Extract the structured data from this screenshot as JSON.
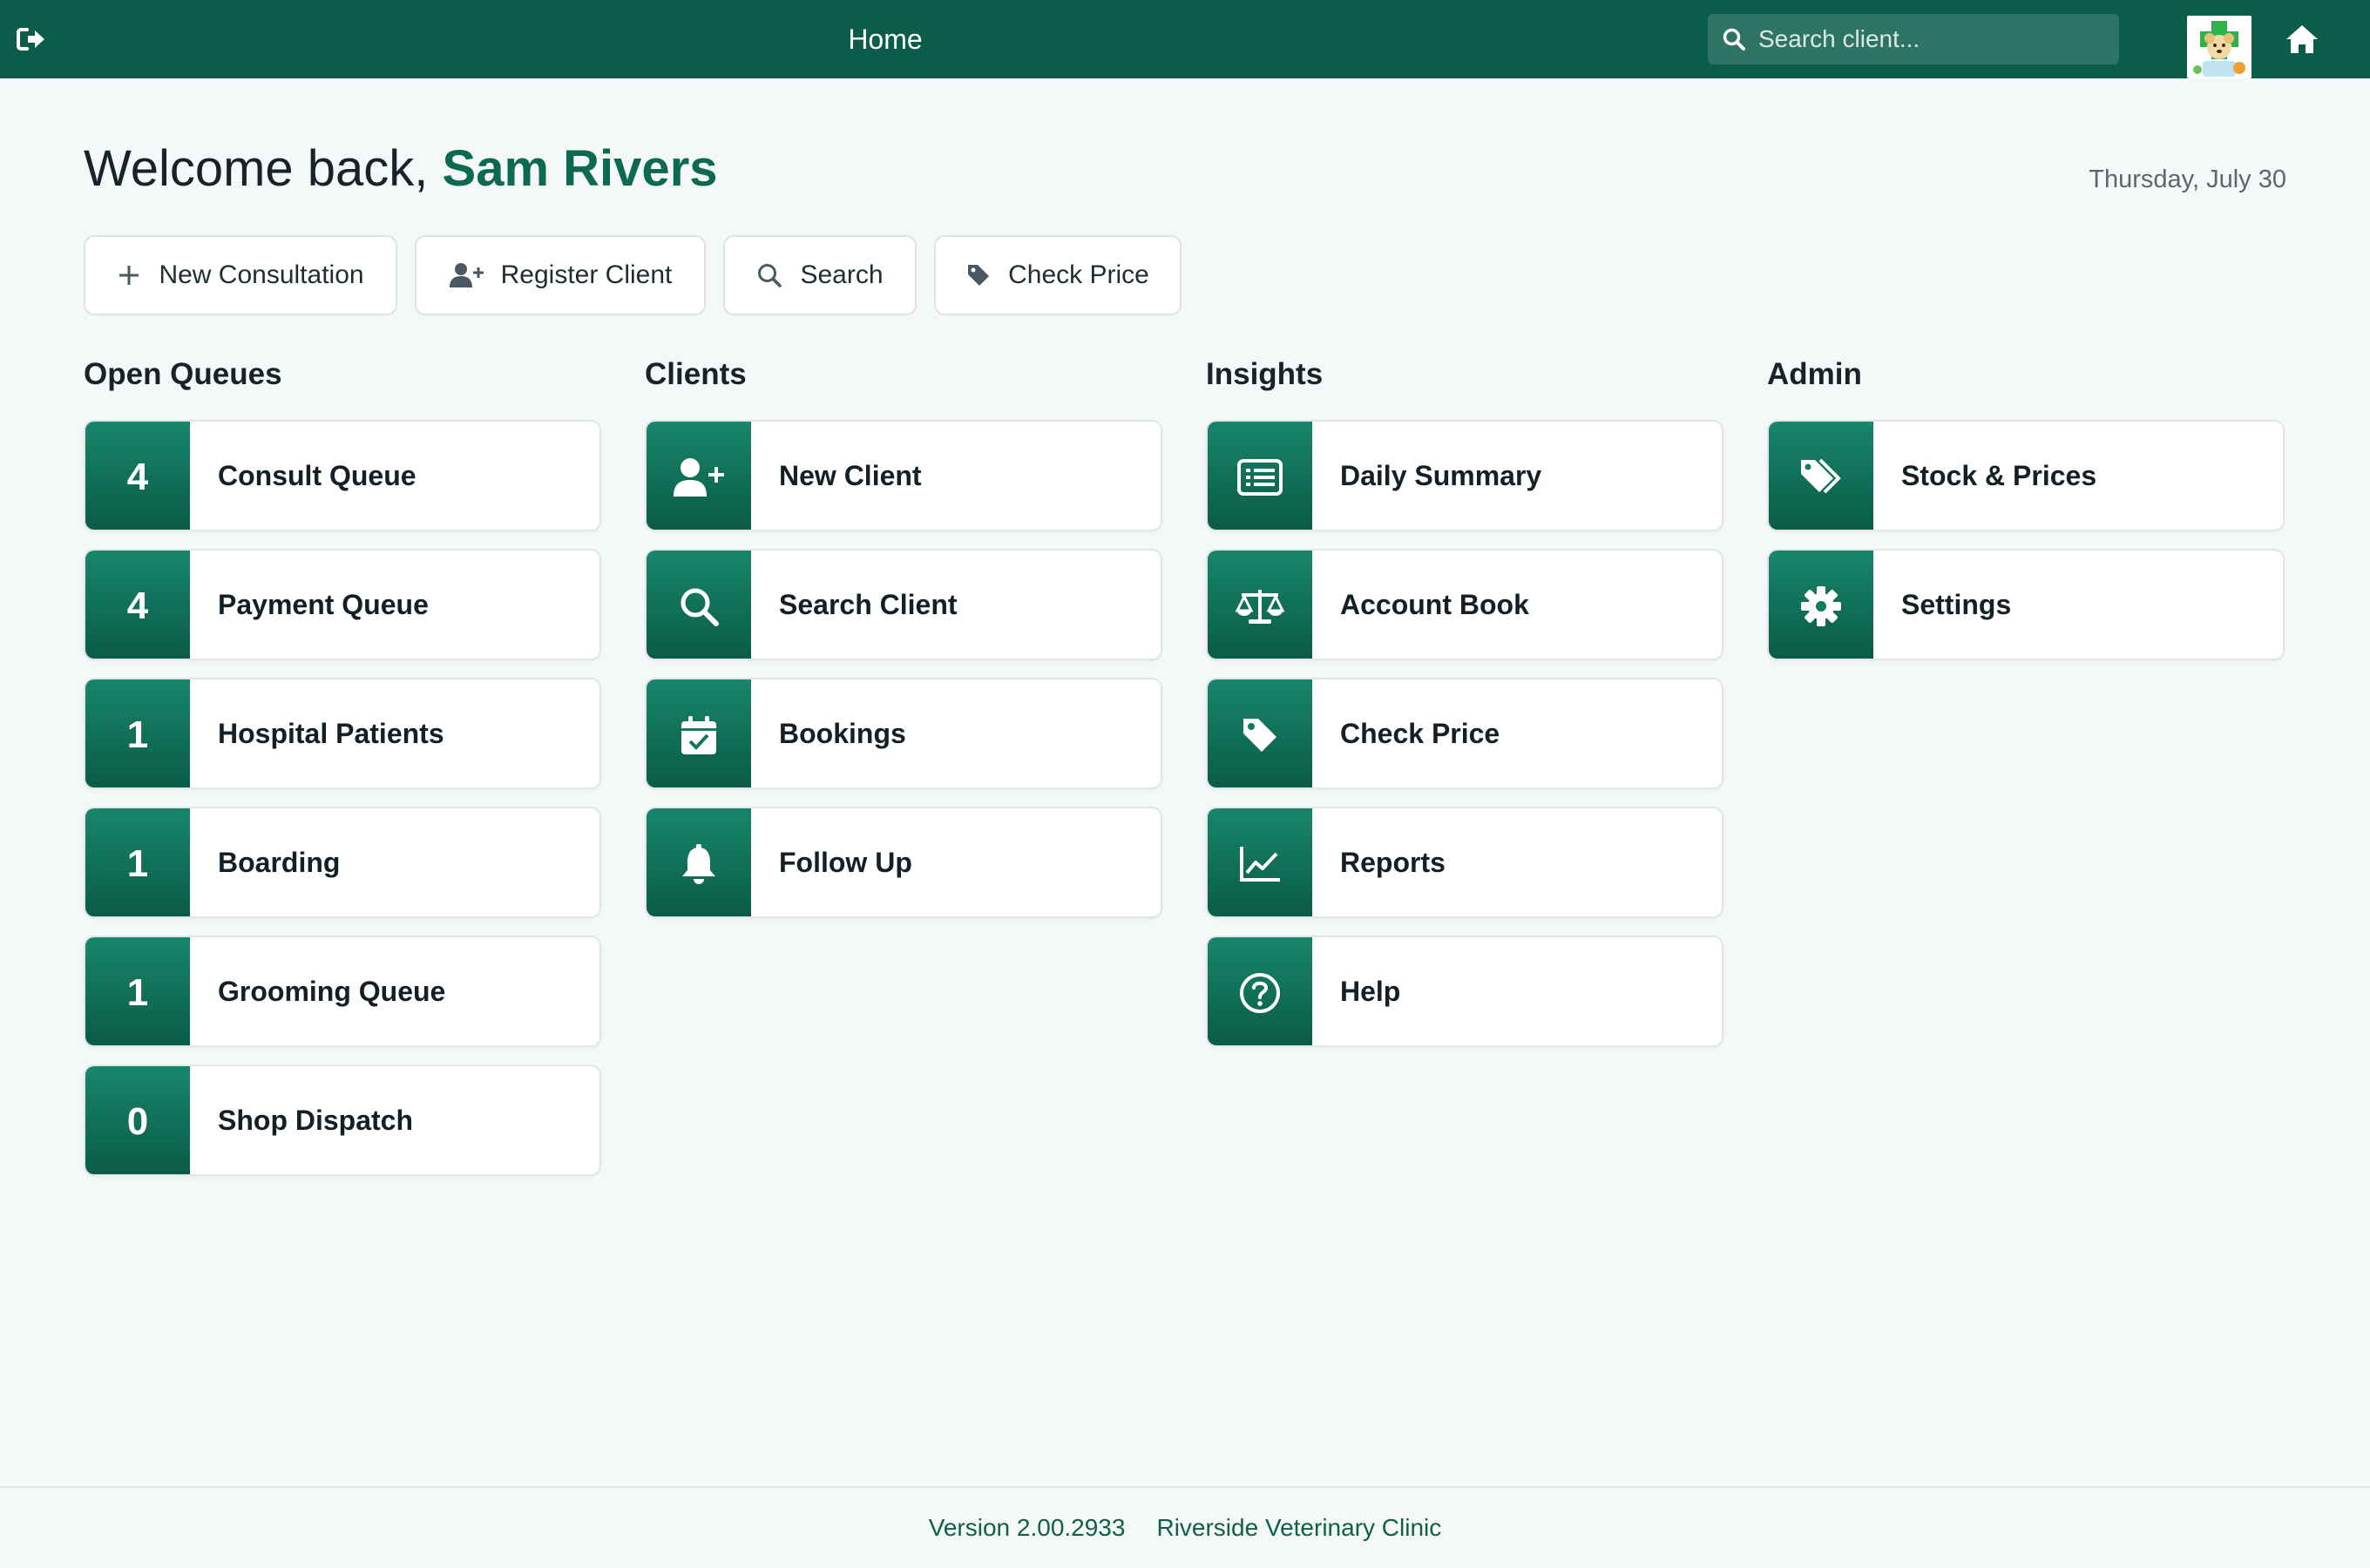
{
  "header": {
    "title": "Home",
    "search_placeholder": "Search client...",
    "icons": [
      "logout-icon",
      "search-icon",
      "clinic-logo",
      "home-icon"
    ]
  },
  "welcome": {
    "greeting": "Welcome back,",
    "user_name": "Sam Rivers",
    "date": "Thursday, July 30"
  },
  "quick_actions": [
    {
      "label": "New Consultation",
      "icon": "plus-icon"
    },
    {
      "label": "Register Client",
      "icon": "user-plus-icon"
    },
    {
      "label": "Search",
      "icon": "search-icon"
    },
    {
      "label": "Check Price",
      "icon": "tag-icon"
    }
  ],
  "columns": [
    {
      "title": "Open Queues",
      "items": [
        {
          "count": "4",
          "label": "Consult Queue"
        },
        {
          "count": "4",
          "label": "Payment Queue"
        },
        {
          "count": "1",
          "label": "Hospital Patients"
        },
        {
          "count": "1",
          "label": "Boarding"
        },
        {
          "count": "1",
          "label": "Grooming Queue"
        },
        {
          "count": "0",
          "label": "Shop Dispatch"
        }
      ]
    },
    {
      "title": "Clients",
      "items": [
        {
          "icon": "user-plus-icon",
          "label": "New Client"
        },
        {
          "icon": "search-icon",
          "label": "Search Client"
        },
        {
          "icon": "calendar-check-icon",
          "label": "Bookings"
        },
        {
          "icon": "bell-icon",
          "label": "Follow Up"
        }
      ]
    },
    {
      "title": "Insights",
      "items": [
        {
          "icon": "list-icon",
          "label": "Daily Summary"
        },
        {
          "icon": "scale-icon",
          "label": "Account Book"
        },
        {
          "icon": "tag-icon",
          "label": "Check Price"
        },
        {
          "icon": "chart-line-icon",
          "label": "Reports"
        },
        {
          "icon": "question-circle-icon",
          "label": "Help"
        }
      ]
    },
    {
      "title": "Admin",
      "items": [
        {
          "icon": "tags-icon",
          "label": "Stock & Prices"
        },
        {
          "icon": "gear-icon",
          "label": "Settings"
        }
      ]
    }
  ],
  "footer": {
    "version": "Version 2.00.2933",
    "clinic": "Riverside Veterinary Clinic"
  },
  "colors": {
    "brand": "#0b5c48",
    "accent": "#0d6a4f",
    "background": "#f4f8f8"
  }
}
